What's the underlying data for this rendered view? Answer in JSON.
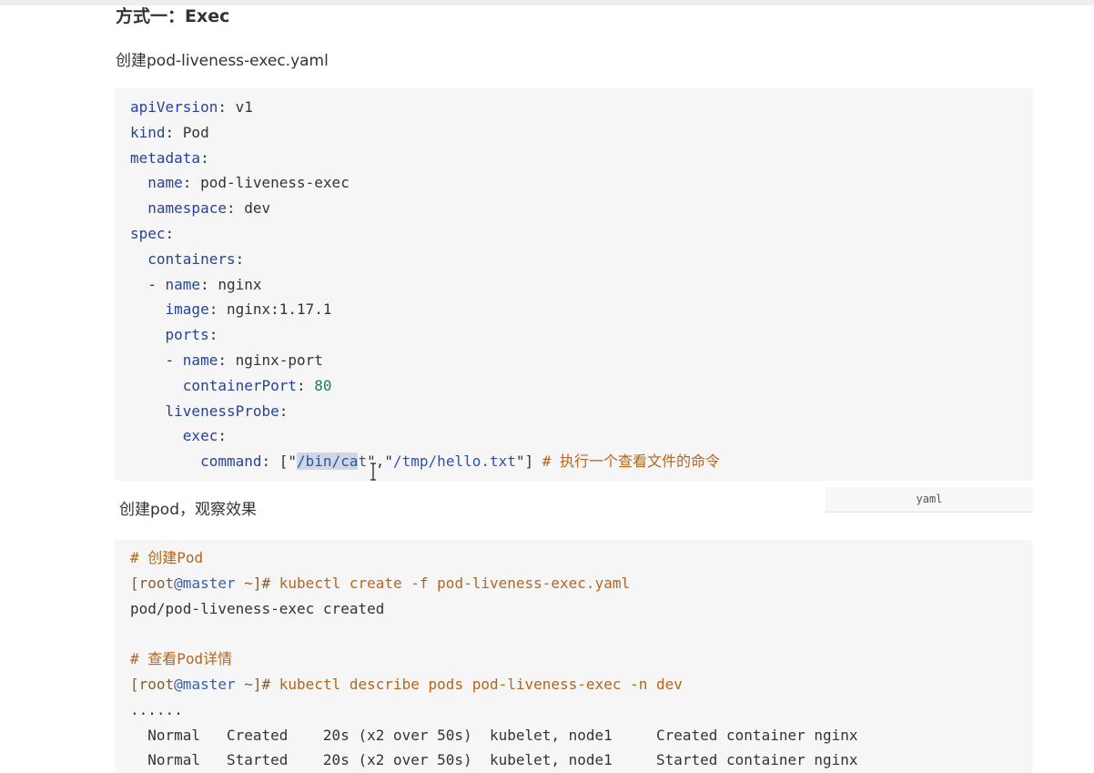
{
  "heading": "方式一：Exec",
  "para1": "创建pod-liveness-exec.yaml",
  "yaml": {
    "l1": {
      "key": "apiVersion",
      "val": "v1"
    },
    "l2": {
      "key": "kind",
      "val": "Pod"
    },
    "l3": {
      "key": "metadata"
    },
    "l4": {
      "key": "name",
      "val": "pod-liveness-exec"
    },
    "l5": {
      "key": "namespace",
      "val": "dev"
    },
    "l6": {
      "key": "spec"
    },
    "l7": {
      "key": "containers"
    },
    "l8": {
      "key": "name",
      "val": "nginx"
    },
    "l9": {
      "key": "image",
      "val": "nginx:1.17.1"
    },
    "l10": {
      "key": "ports"
    },
    "l11": {
      "key": "name",
      "val": "nginx-port"
    },
    "l12": {
      "key": "containerPort",
      "val": "80"
    },
    "l13": {
      "key": "livenessProbe"
    },
    "l14": {
      "key": "exec"
    },
    "l15": {
      "key": "command",
      "arg1_a": "/bin/ca",
      "arg1_b": "t",
      "arg2": "/tmp/hello.txt",
      "comment": "# 执行一个查看文件的命令"
    }
  },
  "lang_tag": "yaml",
  "para2": "创建pod，观察效果",
  "shell": {
    "c1": "# 创建Pod",
    "p1": {
      "user": "[root",
      "host": "@master",
      "rest": " ~]# ",
      "cmd": "kubectl create -f pod-liveness-exec.yaml"
    },
    "o1": "pod/pod-liveness-exec created",
    "c2": "# 查看Pod详情",
    "p2": {
      "user": "[root",
      "host": "@master",
      "rest": " ~]# ",
      "cmd": "kubectl describe pods pod-liveness-exec -n dev"
    },
    "dots": "......",
    "e1": "  Normal   Created    20s (x2 over 50s)  kubelet, node1     Created container nginx",
    "e2": "  Normal   Started    20s (x2 over 50s)  kubelet, node1     Started container nginx"
  }
}
